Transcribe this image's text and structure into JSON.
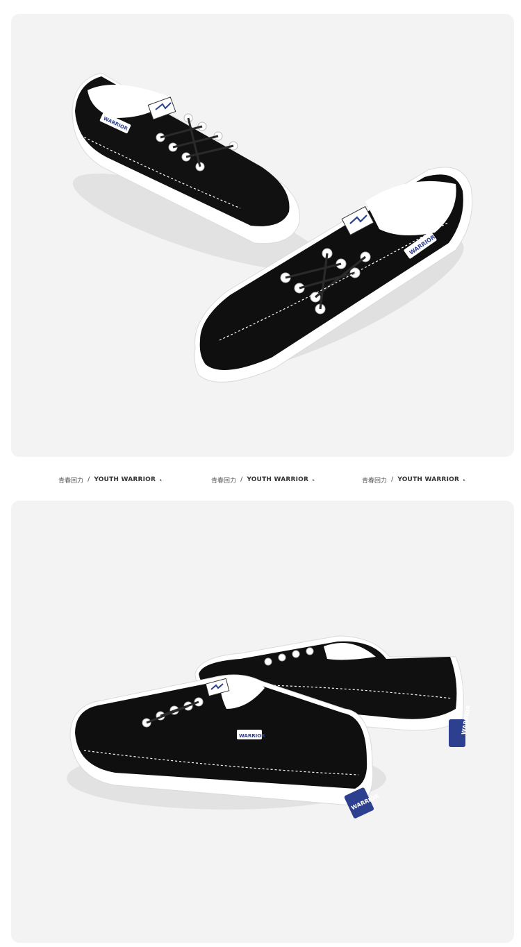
{
  "captions": [
    {
      "cn": "青春回力",
      "separator": "/",
      "en": "YOUTH WARRIOR",
      "arrow": "▸"
    },
    {
      "cn": "青春回力",
      "separator": "/",
      "en": "YOUTH WARRIOR",
      "arrow": "▸"
    },
    {
      "cn": "青春回力",
      "separator": "/",
      "en": "YOUTH WARRIOR",
      "arrow": "▸"
    }
  ],
  "brand": {
    "label_text": "WARRIOR"
  },
  "colors": {
    "panel_bg": "#f3f3f3",
    "canvas": "#000000",
    "sole": "#ffffff",
    "label_blue": "#2d3f8f"
  }
}
